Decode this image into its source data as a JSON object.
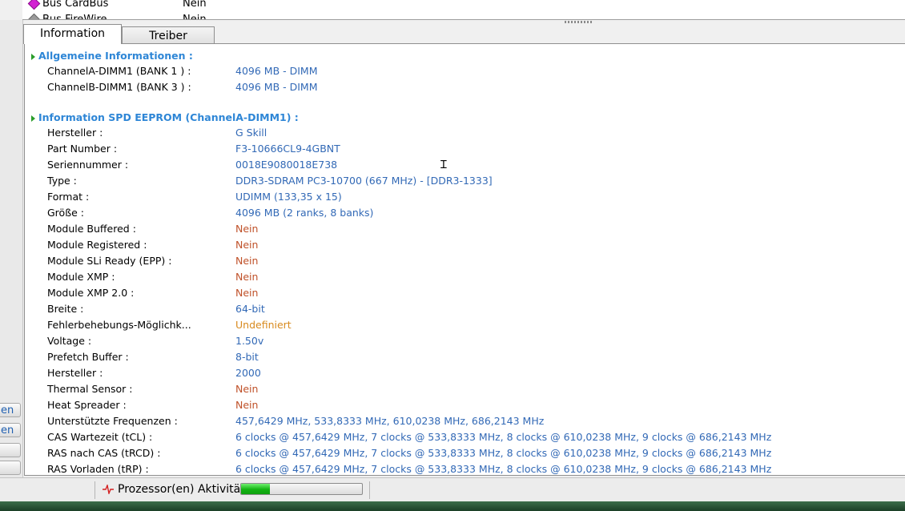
{
  "top_list": {
    "rows": [
      {
        "label": "Bus CardBus",
        "value": "Nein"
      },
      {
        "label": "Bus FireWire",
        "value": "Nein"
      }
    ]
  },
  "left_buttons": [
    "en",
    "en",
    "",
    ""
  ],
  "tabs": [
    {
      "label": "Information",
      "active": true
    },
    {
      "label": "Treiber",
      "active": false
    }
  ],
  "sections": {
    "general": {
      "title": "Allgemeine Informationen :",
      "rows": [
        {
          "label": "ChannelA-DIMM1 (BANK 1 ) :",
          "value": "4096  MB - DIMM",
          "color": "blue"
        },
        {
          "label": "ChannelB-DIMM1 (BANK 3 ) :",
          "value": "4096  MB - DIMM",
          "color": "blue"
        }
      ]
    },
    "spd": {
      "title": "Information SPD EEPROM (ChannelA-DIMM1) :",
      "rows": [
        {
          "label": "Hersteller :",
          "value": "G Skill",
          "color": "blue"
        },
        {
          "label": "Part Number :",
          "value": "F3-10666CL9-4GBNT",
          "color": "blue"
        },
        {
          "label": "Seriennummer :",
          "value": "0018E9080018E738",
          "color": "blue"
        },
        {
          "label": "Type :",
          "value": "DDR3-SDRAM PC3-10700 (667 MHz)  -  [DDR3-1333]",
          "color": "blue"
        },
        {
          "label": "Format :",
          "value": "UDIMM (133,35 x 15)",
          "color": "blue"
        },
        {
          "label": "Größe :",
          "value": "4096  MB (2 ranks, 8 banks)",
          "color": "blue"
        },
        {
          "label": "Module Buffered :",
          "value": "Nein",
          "color": "red"
        },
        {
          "label": "Module Registered :",
          "value": "Nein",
          "color": "red"
        },
        {
          "label": "Module SLi Ready (EPP) :",
          "value": "Nein",
          "color": "red"
        },
        {
          "label": "Module XMP :",
          "value": "Nein",
          "color": "red"
        },
        {
          "label": "Module XMP 2.0 :",
          "value": "Nein",
          "color": "red"
        },
        {
          "label": "Breite :",
          "value": "64-bit",
          "color": "blue"
        },
        {
          "label": "Fehlerbehebungs-Möglichk...",
          "value": "Undefiniert",
          "color": "orange"
        },
        {
          "label": "Voltage :",
          "value": "1.50v",
          "color": "blue"
        },
        {
          "label": "Prefetch Buffer :",
          "value": "8-bit",
          "color": "blue"
        },
        {
          "label": "Hersteller :",
          "value": "2000",
          "color": "blue"
        },
        {
          "label": "Thermal Sensor :",
          "value": "Nein",
          "color": "red"
        },
        {
          "label": "Heat Spreader :",
          "value": "Nein",
          "color": "red"
        },
        {
          "label": "Unterstützte Frequenzen :",
          "value": "457,6429 MHz, 533,8333 MHz, 610,0238 MHz, 686,2143 MHz",
          "color": "blue"
        },
        {
          "label": "CAS Wartezeit (tCL) :",
          "value": "6 clocks @ 457,6429 MHz, 7 clocks @ 533,8333 MHz, 8 clocks @ 610,0238 MHz, 9 clocks @ 686,2143 MHz",
          "color": "blue"
        },
        {
          "label": "RAS nach CAS (tRCD) :",
          "value": "6 clocks @ 457,6429 MHz, 7 clocks @ 533,8333 MHz, 8 clocks @ 610,0238 MHz, 9 clocks @ 686,2143 MHz",
          "color": "blue"
        },
        {
          "label": "RAS Vorladen (tRP) :",
          "value": "6 clocks @ 457,6429 MHz, 7 clocks @ 533,8333 MHz, 8 clocks @ 610,0238 MHz, 9 clocks @ 686,2143 MHz",
          "color": "blue"
        }
      ]
    }
  },
  "status_bar": {
    "label": "Prozessor(en) Aktivität :",
    "progress_percent": 24,
    "icon": "pulse-icon"
  },
  "colors": {
    "section_title": "#2e86d6",
    "value_blue": "#3269b6",
    "value_red": "#c0522a",
    "value_orange": "#d88a1e",
    "progress_green": "#12b312"
  }
}
